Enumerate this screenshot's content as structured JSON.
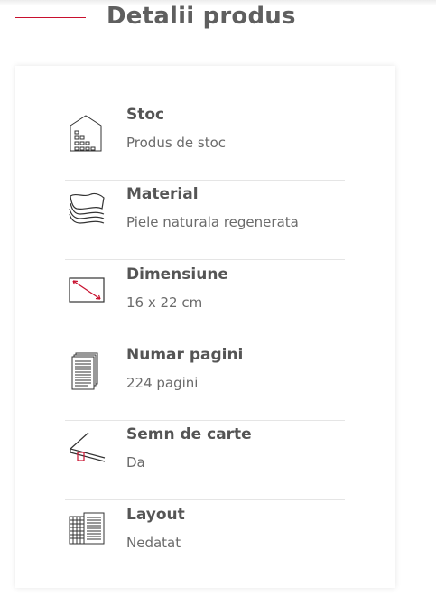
{
  "section": {
    "title": "Detalii produs",
    "accent_color": "#c8102e"
  },
  "details": [
    {
      "icon": "warehouse-icon",
      "label": "Stoc",
      "value": "Produs de stoc"
    },
    {
      "icon": "leather-layers-icon",
      "label": "Material",
      "value": "Piele naturala regenerata"
    },
    {
      "icon": "dimension-rectangle-icon",
      "label": "Dimensiune",
      "value": "16 x 22 cm"
    },
    {
      "icon": "pages-icon",
      "label": "Numar pagini",
      "value": "224 pagini"
    },
    {
      "icon": "bookmark-ribbon-icon",
      "label": "Semn de carte",
      "value": "Da"
    },
    {
      "icon": "layout-grid-icon",
      "label": "Layout",
      "value": "Nedatat"
    }
  ]
}
